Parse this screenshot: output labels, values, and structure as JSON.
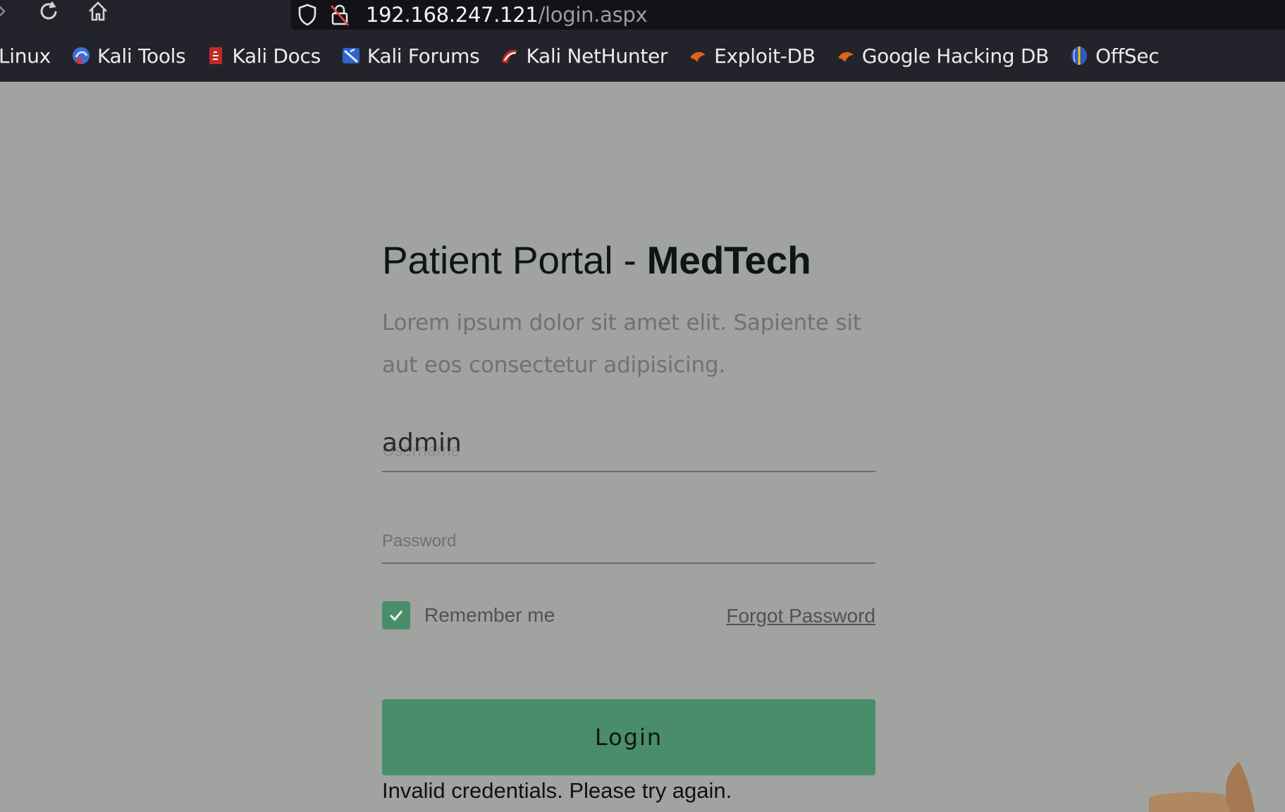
{
  "browser": {
    "url_host": "192.168.247.121",
    "url_path": "/login.aspx",
    "bookmarks": [
      {
        "label": "Linux"
      },
      {
        "label": "Kali Tools"
      },
      {
        "label": "Kali Docs"
      },
      {
        "label": "Kali Forums"
      },
      {
        "label": "Kali NetHunter"
      },
      {
        "label": "Exploit-DB"
      },
      {
        "label": "Google Hacking DB"
      },
      {
        "label": "OffSec"
      }
    ]
  },
  "login": {
    "title_prefix": "Patient Portal - ",
    "title_brand": "MedTech",
    "subtitle": "Lorem ipsum dolor sit amet elit. Sapiente sit aut eos consectetur adipisicing.",
    "username_placeholder": "Username",
    "username_value": "admin",
    "password_placeholder": "Password",
    "remember_label": "Remember me",
    "remember_checked": true,
    "forgot_label": "Forgot Password",
    "button_label": "Login",
    "error_message": "Invalid credentials. Please try again."
  },
  "colors": {
    "accent": "#4a8d6b",
    "page_bg": "#a1a3a1",
    "chrome_bg": "#23242b"
  }
}
